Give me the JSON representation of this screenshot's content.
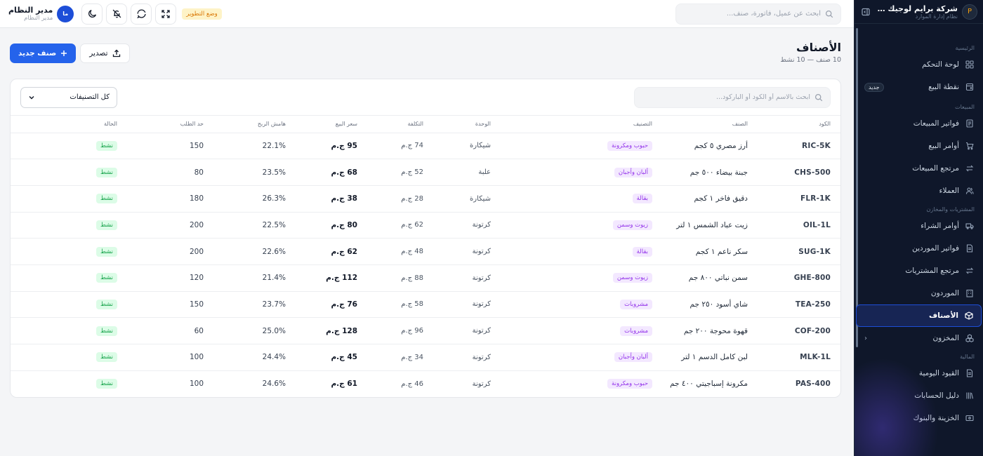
{
  "sidebar": {
    "brand_name": "شركة براي‍م لوجيك التجر...",
    "brand_sub": "نظام إدارة الموارد",
    "sections": {
      "main": "الرئيسية",
      "sales": "المبيعات",
      "purchases": "المشتريات والمخازن",
      "finance": "المالية"
    },
    "items": {
      "dashboard": "لوحة التحكم",
      "pos": "نقطة البيع",
      "pos_badge": "جديد",
      "sales_invoices": "فواتير المبيعات",
      "sales_orders": "أوامر البيع",
      "sales_returns": "مرتجع المبيعات",
      "customers": "العملاء",
      "purchase_orders": "أوامر الشراء",
      "supplier_invoices": "فواتير الموردين",
      "purchase_returns": "مرتجع المشتريات",
      "suppliers": "الموردون",
      "items": "الأصناف",
      "inventory": "المخزون",
      "journal": "القيود اليومية",
      "accounts": "دليل الحسابات",
      "treasury": "الخزينة والبنوك"
    }
  },
  "topbar": {
    "search_placeholder": "ابحث عن عميل، فاتورة، صنف...",
    "dev_mode": "وضع التطوير",
    "user_name": "مدير النظام",
    "user_role": "مدير النظام",
    "avatar": "ما"
  },
  "page": {
    "title": "الأصناف",
    "subtitle": "10 صنف — 10 نشط",
    "export_label": "تصدير",
    "new_label": "صنف جديد"
  },
  "filters": {
    "search_placeholder": "ابحث بالاسم أو الكود أو الباركود...",
    "category_selected": "كل التصنيفات"
  },
  "table": {
    "headers": {
      "code": "الكود",
      "name": "الصنف",
      "category": "التصنيف",
      "unit": "الوحدة",
      "cost": "التكلفة",
      "price": "سعر البيع",
      "margin": "هامش الربح",
      "min": "حد الطلب",
      "status": "الحالة"
    },
    "rows": [
      {
        "code": "RIC-5K",
        "name": "أرز مصري ٥ كجم",
        "category": "حبوب ومكرونة",
        "unit": "شيكارة",
        "cost": "74 ج.م",
        "price": "95 ج.م",
        "margin": "22.1%",
        "min": "150",
        "status": "نشط"
      },
      {
        "code": "CHS-500",
        "name": "جبنة بيضاء ٥٠٠ جم",
        "category": "ألبان وأجبان",
        "unit": "علبة",
        "cost": "52 ج.م",
        "price": "68 ج.م",
        "margin": "23.5%",
        "min": "80",
        "status": "نشط"
      },
      {
        "code": "FLR-1K",
        "name": "دقيق فاخر ١ كجم",
        "category": "بقالة",
        "unit": "شيكارة",
        "cost": "28 ج.م",
        "price": "38 ج.م",
        "margin": "26.3%",
        "min": "180",
        "status": "نشط"
      },
      {
        "code": "OIL-1L",
        "name": "زيت عباد الشمس ١ لتر",
        "category": "زيوت وسمن",
        "unit": "كرتونة",
        "cost": "62 ج.م",
        "price": "80 ج.م",
        "margin": "22.5%",
        "min": "200",
        "status": "نشط"
      },
      {
        "code": "SUG-1K",
        "name": "سكر ناعم ١ كجم",
        "category": "بقالة",
        "unit": "كرتونة",
        "cost": "48 ج.م",
        "price": "62 ج.م",
        "margin": "22.6%",
        "min": "200",
        "status": "نشط"
      },
      {
        "code": "GHE-800",
        "name": "سمن نباتي ٨٠٠ جم",
        "category": "زيوت وسمن",
        "unit": "كرتونة",
        "cost": "88 ج.م",
        "price": "112 ج.م",
        "margin": "21.4%",
        "min": "120",
        "status": "نشط"
      },
      {
        "code": "TEA-250",
        "name": "شاي أسود ٢٥٠ جم",
        "category": "مشروبات",
        "unit": "كرتونة",
        "cost": "58 ج.م",
        "price": "76 ج.م",
        "margin": "23.7%",
        "min": "150",
        "status": "نشط"
      },
      {
        "code": "COF-200",
        "name": "قهوة محوجة ٢٠٠ جم",
        "category": "مشروبات",
        "unit": "كرتونة",
        "cost": "96 ج.م",
        "price": "128 ج.م",
        "margin": "25.0%",
        "min": "60",
        "status": "نشط"
      },
      {
        "code": "MLK-1L",
        "name": "لبن كامل الدسم ١ لتر",
        "category": "ألبان وأجبان",
        "unit": "كرتونة",
        "cost": "34 ج.م",
        "price": "45 ج.م",
        "margin": "24.4%",
        "min": "100",
        "status": "نشط"
      },
      {
        "code": "PAS-400",
        "name": "مكرونة إسباجيتي ٤٠٠ جم",
        "category": "حبوب ومكرونة",
        "unit": "كرتونة",
        "cost": "46 ج.م",
        "price": "61 ج.م",
        "margin": "24.6%",
        "min": "100",
        "status": "نشط"
      }
    ]
  },
  "colors": {
    "primary": "#2563eb",
    "sidebar_bg": "#0f172a",
    "status_active": "#16a34a",
    "chip": "#9333ea"
  }
}
